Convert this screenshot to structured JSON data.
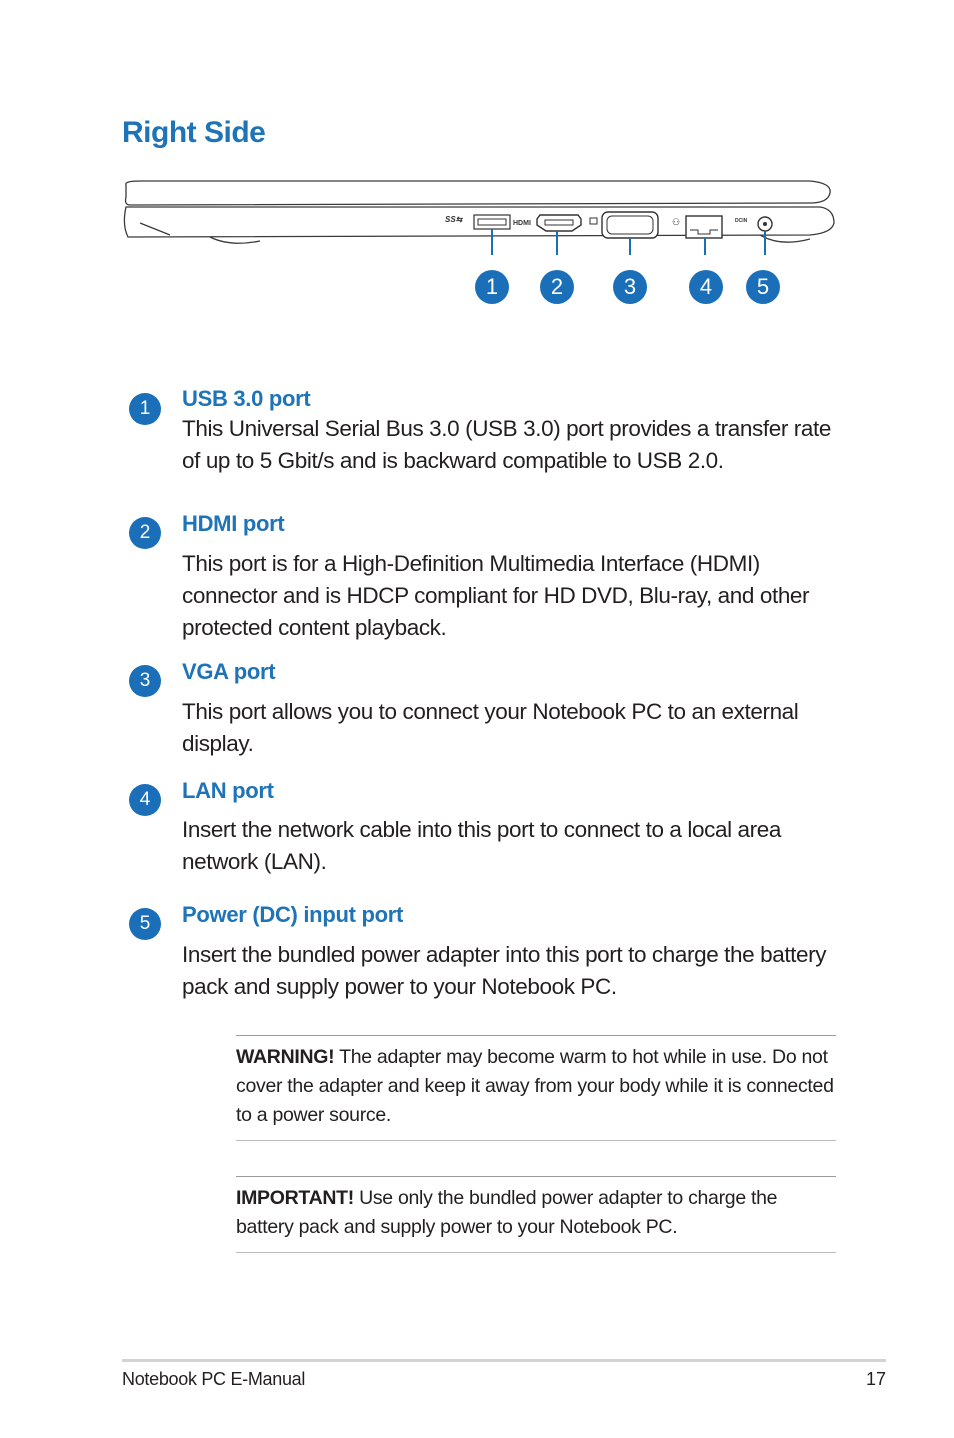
{
  "page": {
    "title": "Right Side",
    "accent_color": "#1f73b7",
    "diagram": {
      "port_labels": [
        "SS",
        "HDMI",
        "DCIN"
      ],
      "callouts": [
        "1",
        "2",
        "3",
        "4",
        "5"
      ]
    },
    "items": [
      {
        "number": "1",
        "title": "USB 3.0 port",
        "description": "This Universal Serial Bus 3.0 (USB 3.0) port provides a transfer rate of up to 5 Gbit/s and is backward compatible to USB 2.0."
      },
      {
        "number": "2",
        "title": "HDMI port",
        "description": "This port is for a High-Definition Multimedia Interface (HDMI) connector and is HDCP compliant for HD DVD, Blu-ray, and other protected content playback."
      },
      {
        "number": "3",
        "title": "VGA port",
        "description": "This port allows you to connect your Notebook PC to an external display."
      },
      {
        "number": "4",
        "title": "LAN port",
        "description": "Insert the network cable into this port to connect to a local area network (LAN)."
      },
      {
        "number": "5",
        "title": "Power (DC) input port",
        "description": "Insert the bundled power adapter into this port to charge the battery pack and supply power to your Notebook PC."
      }
    ],
    "notes": [
      {
        "label": "WARNING!",
        "text": " The adapter may become warm to hot while in use. Do not cover the adapter and keep it away from your body while it is connected to a power source."
      },
      {
        "label": "IMPORTANT!",
        "text": " Use only the bundled power adapter to charge the battery pack and supply power to your Notebook PC."
      }
    ],
    "footer": {
      "manual_name": "Notebook PC E-Manual",
      "page_number": "17"
    }
  }
}
